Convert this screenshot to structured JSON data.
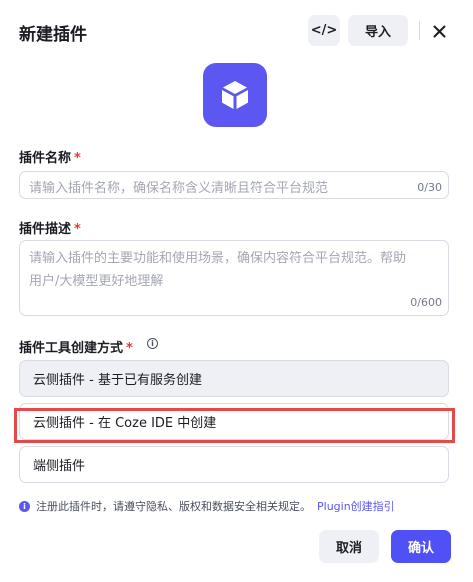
{
  "dialog": {
    "title": "新建插件",
    "code_button_label": "</>",
    "import_button_label": "导入",
    "close_icon": "close-icon"
  },
  "plugin_icon": "cube-icon",
  "name_field": {
    "label": "插件名称",
    "required_mark": "*",
    "placeholder": "请输入插件名称，确保名称含义清晰且符合平台规范",
    "counter": "0/30"
  },
  "desc_field": {
    "label": "插件描述",
    "required_mark": "*",
    "placeholder_line1": "请输入插件的主要功能和使用场景，确保内容符合平台规范。帮助",
    "placeholder_line2": "用户/大模型更好地理解",
    "counter": "0/600"
  },
  "creation_method": {
    "label": "插件工具创建方式",
    "required_mark": "*",
    "help_icon": "i",
    "options": [
      {
        "label": "云侧插件 - 基于已有服务创建",
        "selected": true
      },
      {
        "label": "云侧插件 - 在 Coze IDE 中创建",
        "selected": false
      },
      {
        "label": "端侧插件",
        "selected": false
      }
    ]
  },
  "notice": {
    "icon": "i",
    "text": "注册此插件时，请遵守隐私、版权和数据安全相关规定。",
    "link": "Plugin创建指引"
  },
  "footer": {
    "cancel_label": "取消",
    "confirm_label": "确认"
  },
  "colors": {
    "accent": "#4f50f5",
    "highlight": "#e34b4b",
    "required": "#e53535"
  }
}
